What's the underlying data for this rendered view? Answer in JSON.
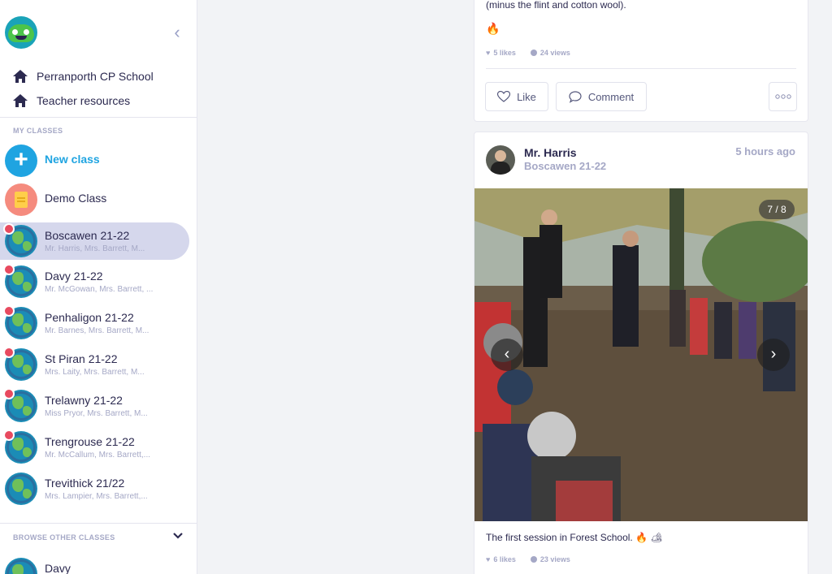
{
  "sidebar": {
    "school_link": "Perranporth CP School",
    "resources_link": "Teacher resources",
    "my_classes_label": "MY CLASSES",
    "new_class_label": "New class",
    "demo_class_label": "Demo Class",
    "classes": [
      {
        "name": "Boscawen 21-22",
        "teachers": "Mr. Harris, Mrs. Barrett, M..."
      },
      {
        "name": "Davy 21-22",
        "teachers": "Mr. McGowan, Mrs. Barrett, ..."
      },
      {
        "name": "Penhaligon 21-22",
        "teachers": "Mr. Barnes, Mrs. Barrett, M..."
      },
      {
        "name": "St Piran 21-22",
        "teachers": "Mrs. Laity, Mrs. Barrett, M..."
      },
      {
        "name": "Trelawny 21-22",
        "teachers": "Miss Pryor, Mrs. Barrett, M..."
      },
      {
        "name": "Trengrouse 21-22",
        "teachers": "Mr. McCallum, Mrs. Barrett,..."
      },
      {
        "name": "Trevithick 21/22",
        "teachers": "Mrs. Lampier, Mrs. Barrett,..."
      }
    ],
    "browse_label": "BROWSE OTHER CLASSES",
    "browse_first": "Davy"
  },
  "post1": {
    "text": "(minus the flint and cotton wool).",
    "emoji": "🔥",
    "likes": "5 likes",
    "views": "24 views",
    "like_label": "Like",
    "comment_label": "Comment"
  },
  "post2": {
    "author": "Mr. Harris",
    "class": "Boscawen 21-22",
    "time": "5 hours ago",
    "counter": "7 / 8",
    "caption": "The first session in Forest School. 🔥 🏕",
    "likes": "6 likes",
    "views": "23 views"
  },
  "colors": {
    "accent": "#1fa4e1",
    "active_bg": "#d5d7ec",
    "notification": "#e84a5f",
    "muted": "#a5a8c6"
  }
}
